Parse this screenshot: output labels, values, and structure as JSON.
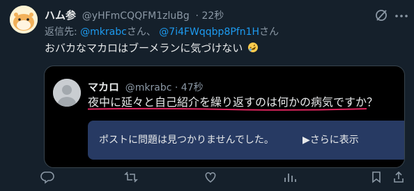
{
  "post": {
    "display_name": "ハム参",
    "handle": "@yHFmCQQFM1zluBg",
    "time": "· 22秒",
    "reply_prefix": "返信先:",
    "reply_mention_1": "@mkrabc",
    "reply_sep": "さん、",
    "reply_mention_2": "@7i4FWqqbp8Pfn1H",
    "reply_suffix": "さん",
    "text": "おバカなマカロはブーメランに気づけない",
    "emoji": "rolling-on-floor-laughing-emoji"
  },
  "quote": {
    "display_name": "マカロ",
    "handle": "@mkrabc · 47秒",
    "text": "夜中に延々と自己紹介を繰り返すのは何かの病気ですか？",
    "notice": "ポストに問題は見つかりませんでした。",
    "notice_link": "▶さらに表示"
  },
  "icons": [
    "grok-icon",
    "more-icon",
    "reply-icon",
    "repost-icon",
    "like-icon",
    "views-icon",
    "bookmark-icon",
    "share-icon"
  ],
  "colors": {
    "background": "#15202b",
    "accent": "#1d9bf0",
    "muted": "#8b98a5",
    "quote_background": "#000000",
    "notice_background": "#273a63",
    "underline": "#e0245e"
  }
}
